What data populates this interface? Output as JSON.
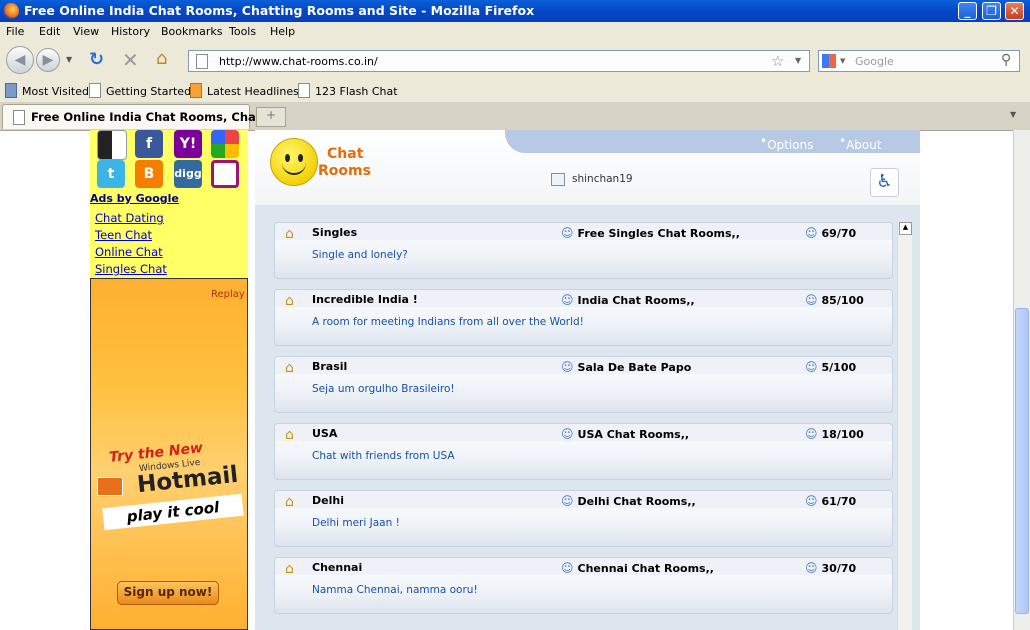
{
  "window": {
    "title": "Free Online India Chat Rooms, Chatting Rooms and Site - Mozilla Firefox"
  },
  "menu": [
    "File",
    "Edit",
    "View",
    "History",
    "Bookmarks",
    "Tools",
    "Help"
  ],
  "nav": {
    "url": "http://www.chat-rooms.co.in/",
    "search_placeholder": "Google"
  },
  "bookmarks": [
    "Most Visited",
    "Getting Started",
    "Latest Headlines",
    "123 Flash Chat"
  ],
  "tab": {
    "title": "Free Online India Chat Rooms, Chatti..."
  },
  "left": {
    "ads_title": "Ads by Google",
    "links": [
      "Chat Dating",
      "Teen Chat",
      "Online Chat",
      "Singles Chat"
    ],
    "ad": {
      "replay": "Replay",
      "line1": "Try the New",
      "line2": "Windows Live",
      "line3": "Hotmail",
      "line4": "play it cool",
      "cta": "Sign up now!"
    }
  },
  "chat": {
    "logo_line1": "Chat",
    "logo_line2": "Rooms",
    "options": "Options",
    "about": "About",
    "username": "shinchan19",
    "rooms": [
      {
        "name": "Singles",
        "room": "Free Singles Chat Rooms,,",
        "count": "69/70",
        "desc": "Single and lonely?"
      },
      {
        "name": "Incredible India !",
        "room": "India Chat Rooms,,",
        "count": "85/100",
        "desc": "A room for meeting Indians from all over the World!"
      },
      {
        "name": "Brasil",
        "room": "Sala De Bate Papo",
        "count": "5/100",
        "desc": "Seja um orgulho Brasileiro!"
      },
      {
        "name": "USA",
        "room": "USA Chat Rooms,,",
        "count": "18/100",
        "desc": "Chat with friends from USA"
      },
      {
        "name": "Delhi",
        "room": "Delhi Chat Rooms,,",
        "count": "61/70",
        "desc": "Delhi meri Jaan !"
      },
      {
        "name": "Chennai",
        "room": "Chennai Chat Rooms,,",
        "count": "30/70",
        "desc": "Namma Chennai, namma ooru!"
      }
    ]
  },
  "colors": {
    "titlebar": "#0a4fd0",
    "chrome": "#ece9d8",
    "left_bg": "#ffff66",
    "panel": "#dde5ef"
  }
}
